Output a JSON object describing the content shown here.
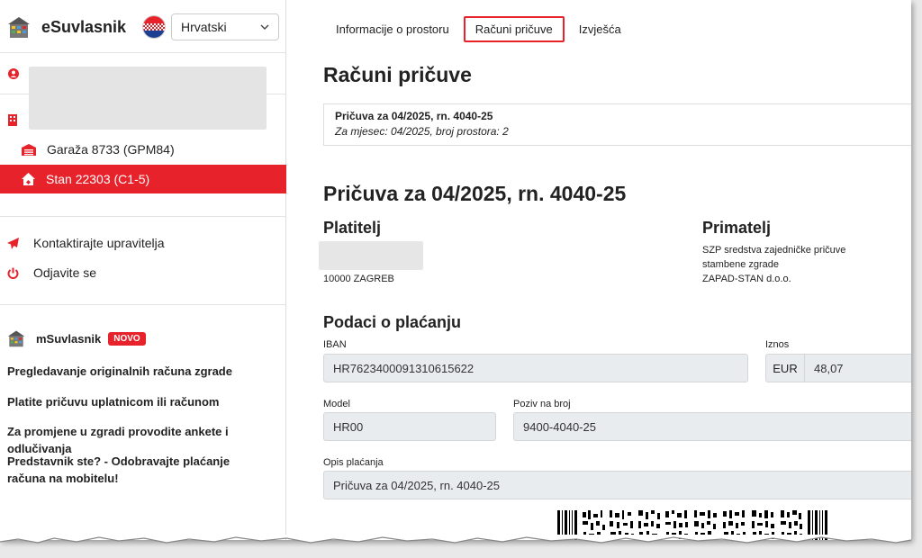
{
  "app": {
    "name": "eSuvlasnik"
  },
  "language": {
    "selected": "Hrvatski"
  },
  "sidebar": {
    "properties": [
      {
        "label": "Garaža 8733 (GPM84)",
        "active": false
      },
      {
        "label": "Stan 22303 (C1-5)",
        "active": true
      }
    ],
    "actions": [
      {
        "label": "Kontaktirajte upravitelja",
        "icon": "paper-plane-icon"
      },
      {
        "label": "Odjavite se",
        "icon": "power-icon"
      }
    ],
    "promo": {
      "name": "mSuvlasnik",
      "badge": "NOVO",
      "lines": [
        "Pregledavanje originalnih računa zgrade",
        "Platite pričuvu uplatnicom ili računom",
        "Za promjene u zgradi provodite ankete i odlučivanja",
        "Predstavnik ste? - Odobravajte plaćanje računa na mobitelu!"
      ]
    }
  },
  "tabs": [
    {
      "label": "Informacije o prostoru"
    },
    {
      "label": "Računi pričuve",
      "active": true
    },
    {
      "label": "Izvješća"
    }
  ],
  "main": {
    "title": "Računi pričuve",
    "invoice": {
      "title": "Pričuva za 04/2025, rn. 4040-25",
      "subtitle": "Za mjesec: 04/2025, broj prostora: 2"
    },
    "detail_title": "Pričuva za 04/2025, rn. 4040-25",
    "payer": {
      "heading": "Platitelj",
      "city": "10000 ZAGREB"
    },
    "recipient": {
      "heading": "Primatelj",
      "lines": [
        "SZP sredstva zajedničke pričuve",
        "stambene zgrade",
        "ZAPAD-STAN d.o.o."
      ]
    },
    "payment": {
      "heading": "Podaci o plaćanju",
      "iban_label": "IBAN",
      "iban": "HR7623400091310615622",
      "amount_label": "Iznos",
      "currency": "EUR",
      "amount": "48,07",
      "model_label": "Model",
      "model": "HR00",
      "reference_label": "Poziv na broj",
      "reference": "9400-4040-25",
      "description_label": "Opis plaćanja",
      "description": "Pričuva za 04/2025, rn. 4040-25"
    }
  },
  "colors": {
    "accent": "#e8222b"
  }
}
